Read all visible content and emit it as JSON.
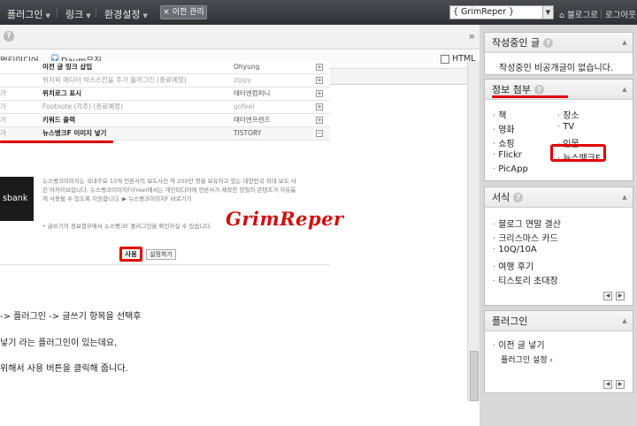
{
  "topbar": {
    "menus": [
      "플러그인",
      "링크",
      "환경설정"
    ],
    "prev_manage": "이전 관리",
    "blog_select": "{ GrimReper }",
    "links": [
      "블로그로",
      "로그아웃"
    ]
  },
  "editor": {
    "toolbar_labels": [
      "멀티미디어",
      "Daum뮤직",
      "HTML"
    ]
  },
  "plugin_rows": [
    {
      "c1": "",
      "name": "이전 글 링크 삽입",
      "author": "Ohyung",
      "light": false
    },
    {
      "c1": "",
      "name": "위지윅 에디터 박스스킨을 추가 플러그인 (종료예정)",
      "author": "zippy",
      "light": true
    },
    {
      "c1": "가",
      "name": "위치로그 표시",
      "author": "태터앤컴퍼니",
      "light": false
    },
    {
      "c1": "가",
      "name": "Footnote (각주) (종료예정)",
      "author": "gofeel",
      "light": true
    },
    {
      "c1": "가",
      "name": "키워드 출력",
      "author": "태터앤프렌즈",
      "light": false
    },
    {
      "c1": "가",
      "name": "뉴스뱅크F 이미지 넣기",
      "author": "TISTORY",
      "light": false
    }
  ],
  "plugin_detail": {
    "logo": "sbank",
    "description": "뉴스뱅크이미지는 국내주요 13개 언론사의 보도사진 약 200만 컷을 보유하고 있는 대한민국 최대 보도 사진 아카이브입니다. 뉴스뱅크이미지F(Free)에서는 개인미디어에 언론사가 제작한 양질의 콘텐츠가 자유롭게 사용될 수 있도록 지원합니다. ▶ 뉴스뱅크이미지F 바로가기",
    "note": "• 글쓰기의 정보첨부에서 뉴스뱅크F 플러그인을 확인하실 수 있습니다.",
    "watermark": "GrimReper",
    "use_button": "사용",
    "settings_button": "설정하기"
  },
  "body_lines": [
    "-> 플러그인 -> 글쓰기 항목을 선택후",
    "넣기 라는 플러그인이 있는데요,",
    "위해서 사용 버튼을 클릭해 줍니다."
  ],
  "sidebar": {
    "writing": {
      "title": "작성중인 글",
      "empty": "작성중인 비공개글이 없습니다."
    },
    "info": {
      "title": "정보 첨부",
      "left": [
        "책",
        "영화",
        "쇼핑",
        "Flickr",
        "PicApp"
      ],
      "right": [
        "장소",
        "TV",
        "인물",
        "뉴스뱅크F"
      ]
    },
    "format": {
      "title": "서식",
      "items": [
        "블로그 연말 결산",
        "크리스마스 카드",
        "10Q/10A",
        "여행 후기",
        "티스토리 초대장"
      ]
    },
    "plugin": {
      "title": "플러그인",
      "items": [
        "이전 글 넣기",
        "플러그인 설정 ›"
      ]
    }
  }
}
